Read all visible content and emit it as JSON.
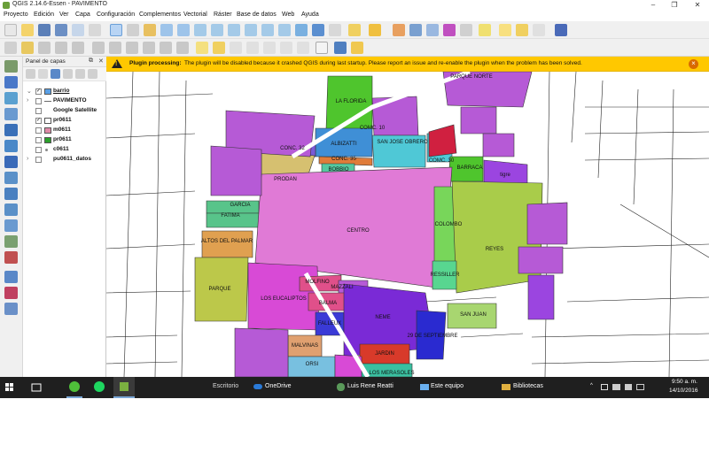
{
  "window": {
    "title": "QGIS 2.14.6-Essen - PAVIMENTO",
    "minimize": "–",
    "maximize": "❐",
    "close": "✕"
  },
  "menubar": {
    "items": [
      "Proyecto",
      "Edición",
      "Ver",
      "Capa",
      "Configuración",
      "Complementos",
      "Vectorial",
      "Ráster",
      "Base de datos",
      "Web",
      "Ayuda"
    ]
  },
  "layers_panel": {
    "title": "Panel de capas",
    "layers": [
      {
        "name": "barrio",
        "checked": true,
        "color": "#5aa0e6",
        "type": "polygon"
      },
      {
        "name": "PAVIMENTO",
        "checked": false,
        "color": "#6a6a6a",
        "type": "line"
      },
      {
        "name": "Google Satellite",
        "checked": false,
        "color": "",
        "type": "raster"
      },
      {
        "name": "pr0611",
        "checked": true,
        "color": "#ffffff",
        "type": "polygon"
      },
      {
        "name": "m0611",
        "checked": false,
        "color": "#e08aa8",
        "type": "polygon"
      },
      {
        "name": "pr0611",
        "checked": false,
        "color": "#2ca02c",
        "type": "polygon"
      },
      {
        "name": "c0611",
        "checked": false,
        "color": "#888888",
        "type": "point"
      },
      {
        "name": "pu0611_datos",
        "checked": false,
        "color": "",
        "type": "table"
      }
    ]
  },
  "message_bar": {
    "title": "Plugin processing:",
    "text": "The plugin will be disabled because it crashed QGIS during last startup. Please report an issue and re-enable the plugin when the problem has been solved."
  },
  "map": {
    "neighborhoods": [
      {
        "name": "PARQUE NORTE",
        "color": "#b65ad6"
      },
      {
        "name": "LA FLORIDA",
        "color": "#4fc52d"
      },
      {
        "name": "COMC. 10",
        "color": "#b65ad6"
      },
      {
        "name": "SAN JOSE OBRERO",
        "color": "#4fc8d6"
      },
      {
        "name": "ALBIZATTI",
        "color": "#3f8fd6"
      },
      {
        "name": "CONC. 32",
        "color": "#7a5ad6"
      },
      {
        "name": "CONC. 35",
        "color": "#e07c3a"
      },
      {
        "name": "COMC. 30",
        "color": "#4fc8d6"
      },
      {
        "name": "BARRACA",
        "color": "#4fc52d"
      },
      {
        "name": "tigre",
        "color": "#9b45e0"
      },
      {
        "name": "BOBBIO",
        "color": "#55c9a0"
      },
      {
        "name": "PRODAN",
        "color": "#d6c070"
      },
      {
        "name": "GARCIA",
        "color": "#58c48a"
      },
      {
        "name": "FATIMA",
        "color": "#58c48a"
      },
      {
        "name": "CENTRO",
        "color": "#e07ad6"
      },
      {
        "name": "COLOMBO",
        "color": "#78d65a"
      },
      {
        "name": "REYES",
        "color": "#a9cc4a"
      },
      {
        "name": "ALTOS DEL PALMAR",
        "color": "#e0a050"
      },
      {
        "name": "PARQUE",
        "color": "#bcc84a"
      },
      {
        "name": "LOS EUCALIPTOS",
        "color": "#d84ad6"
      },
      {
        "name": "MOLFINO",
        "color": "#e0508a"
      },
      {
        "name": "MAZZALI",
        "color": "#b65ad6"
      },
      {
        "name": "BALMA",
        "color": "#e0508a"
      },
      {
        "name": "FALLEUX",
        "color": "#3a3ad6"
      },
      {
        "name": "NEME",
        "color": "#7a2ad6"
      },
      {
        "name": "RESSILLER",
        "color": "#58d690"
      },
      {
        "name": "SAN JUAN",
        "color": "#a8d670"
      },
      {
        "name": "29 DE SEPTIEMBRE",
        "color": "#2a2ad0"
      },
      {
        "name": "MALVINAS",
        "color": "#e0a070"
      },
      {
        "name": "ORSI",
        "color": "#78c0e0"
      },
      {
        "name": "JARDIN",
        "color": "#d83a2a"
      },
      {
        "name": "LOS MERASOLES",
        "color": "#3ac0a0"
      }
    ]
  },
  "taskbar": {
    "search_label": "Escritorio",
    "items": [
      {
        "label": "OneDrive"
      },
      {
        "label": "Luis Rene Reatti"
      },
      {
        "label": "Este equipo"
      },
      {
        "label": "Bibliotecas"
      }
    ],
    "time": "9:50 a. m.",
    "date": "14/10/2016"
  },
  "colors": {
    "warning": "#ffc800",
    "taskbar": "#1f1f1f",
    "accent": "#7aa7d6"
  }
}
